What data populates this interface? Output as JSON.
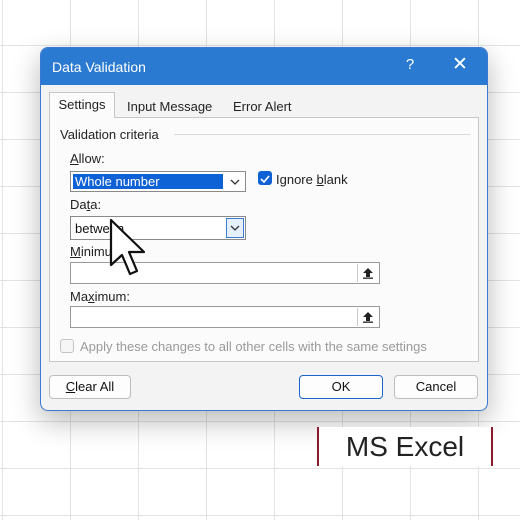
{
  "dialog": {
    "title": "Data Validation",
    "help_glyph": "?",
    "close_glyph": "✕"
  },
  "tabs": [
    {
      "label": "Settings",
      "active": true
    },
    {
      "label": "Input Message",
      "active": false
    },
    {
      "label": "Error Alert",
      "active": false
    }
  ],
  "settings": {
    "section_label": "Validation criteria",
    "allow": {
      "label_key": "A",
      "label_rest": "llow:",
      "value": "Whole number"
    },
    "ignore_blank": {
      "label_pre": "Ignore ",
      "label_key": "b",
      "label_rest": "lank",
      "checked": true
    },
    "data": {
      "label_pre": "Da",
      "label_key": "t",
      "label_rest": "a:",
      "value": "between"
    },
    "minimum": {
      "label_key": "M",
      "label_rest": "inimu",
      "value": ""
    },
    "maximum": {
      "label_pre": "Ma",
      "label_key": "x",
      "label_rest": "imum:",
      "value": ""
    },
    "apply_all": {
      "label": "Apply these changes to all other cells with the same settings",
      "checked": false,
      "enabled": false
    }
  },
  "buttons": {
    "clear_key": "C",
    "clear_rest": "lear All",
    "ok": "OK",
    "cancel": "Cancel"
  },
  "colors": {
    "titlebar": "#2b7ad1",
    "accent": "#0f61d6",
    "watermark_border": "#8b1a2d"
  },
  "watermark": "MS Excel"
}
